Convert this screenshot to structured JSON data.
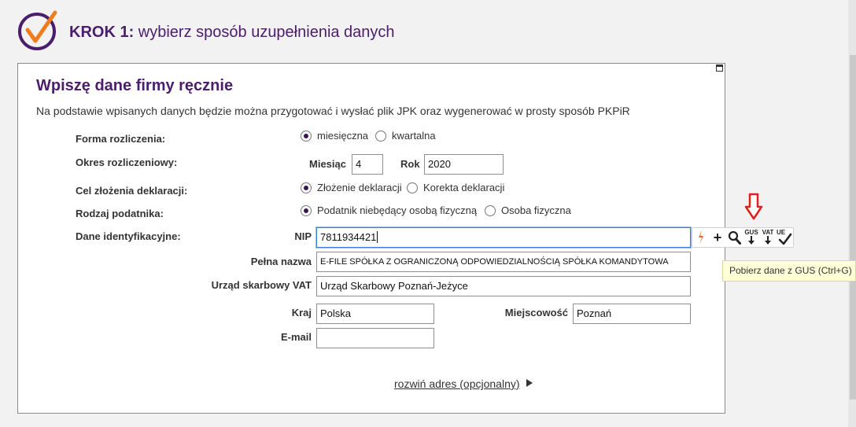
{
  "header": {
    "step_prefix": "KROK 1:",
    "step_text": " wybierz sposób uzupełnienia danych"
  },
  "panel": {
    "title": "Wpiszę dane firmy ręcznie",
    "description": "Na podstawie wpisanych danych będzie można przygotować i wysłać plik JPK oraz wygenerować w prosty sposób PKPiR"
  },
  "form": {
    "forma_rozliczenia": {
      "label": "Forma rozliczenia:",
      "options": [
        "miesięczna",
        "kwartalna"
      ],
      "selected": "miesięczna"
    },
    "okres": {
      "label": "Okres rozliczeniowy:",
      "month_label": "Miesiąc",
      "month_value": "4",
      "year_label": "Rok",
      "year_value": "2020"
    },
    "cel": {
      "label": "Cel złożenia deklaracji:",
      "options": [
        "Złożenie deklaracji",
        "Korekta deklaracji"
      ],
      "selected": "Złożenie deklaracji"
    },
    "rodzaj": {
      "label": "Rodzaj podatnika:",
      "options": [
        "Podatnik niebędący osobą fizyczną",
        "Osoba fizyczna"
      ],
      "selected": "Podatnik niebędący osobą fizyczną"
    },
    "dane_label": "Dane identyfikacyjne:",
    "nip": {
      "label": "NIP",
      "value": "7811934421"
    },
    "nazwa": {
      "label": "Pełna nazwa",
      "value": "E-FILE SPÓŁKA Z OGRANICZONĄ ODPOWIEDZIALNOŚCIĄ SPÓŁKA KOMANDYTOWA"
    },
    "urzad": {
      "label": "Urząd skarbowy VAT",
      "value": "Urząd Skarbowy Poznań-Jeżyce"
    },
    "kraj": {
      "label": "Kraj",
      "value": "Polska"
    },
    "miejscowosc": {
      "label": "Miejscowość",
      "value": "Poznań"
    },
    "email": {
      "label": "E-mail",
      "value": ""
    }
  },
  "toolbar": {
    "icons": [
      "lightning-icon",
      "plus-icon",
      "search-icon",
      "gus-download-icon",
      "vat-download-icon",
      "ue-check-icon"
    ],
    "gus_label": "GUS",
    "vat_label": "VAT",
    "ue_label": "UE"
  },
  "tooltip": {
    "text": "Pobierz dane z GUS (Ctrl+G)"
  },
  "expand": {
    "label": "rozwiń adres (opcjonalny)"
  },
  "colors": {
    "brand": "#4a1e6b",
    "accent": "#f07c1e",
    "arrow": "#e0201c",
    "tooltip_bg": "#ffffd8"
  }
}
